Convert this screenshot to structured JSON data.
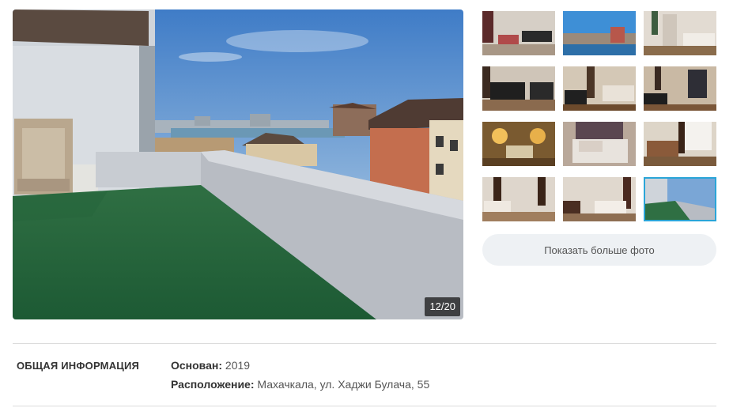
{
  "gallery": {
    "counter": "12/20",
    "more_photos_label": "Показать больше фото",
    "thumbnails": [
      {
        "name": "bedroom-sofa"
      },
      {
        "name": "city-view"
      },
      {
        "name": "bedroom-wardrobe"
      },
      {
        "name": "leather-sofas"
      },
      {
        "name": "room-armchair"
      },
      {
        "name": "room-dresser"
      },
      {
        "name": "bedroom-lamps"
      },
      {
        "name": "bed-closeup"
      },
      {
        "name": "bedroom-window"
      },
      {
        "name": "bedroom-curtains"
      },
      {
        "name": "bedroom-tv"
      },
      {
        "name": "rooftop-terrace"
      }
    ],
    "active_index": 11
  },
  "info": {
    "section_title": "ОБЩАЯ ИНФОРМАЦИЯ",
    "founded_label": "Основан:",
    "founded_value": "2019",
    "location_label": "Расположение:",
    "location_value": "Махачкала, ул. Хаджи Булача, 55"
  }
}
